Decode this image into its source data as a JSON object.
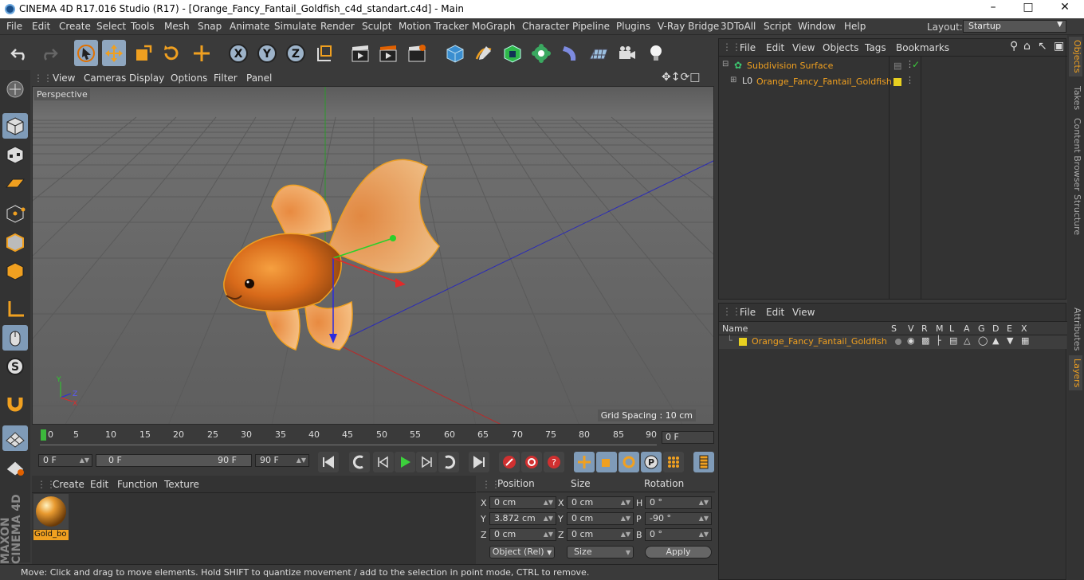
{
  "title": "CINEMA 4D R17.016 Studio (R17) - [Orange_Fancy_Fantail_Goldfish_c4d_standart.c4d] - Main",
  "menu": [
    "File",
    "Edit",
    "Create",
    "Select",
    "Tools",
    "Mesh",
    "Snap",
    "Animate",
    "Simulate",
    "Render",
    "Sculpt",
    "Motion Tracker",
    "MoGraph",
    "Character",
    "Pipeline",
    "Plugins",
    "V-Ray Bridge",
    "3DToAll",
    "Script",
    "Window",
    "Help"
  ],
  "layout": {
    "label": "Layout:",
    "value": "Startup"
  },
  "viewport_menu": [
    "View",
    "Cameras",
    "Display",
    "Options",
    "Filter",
    "Panel"
  ],
  "viewport": {
    "label": "Perspective",
    "grid_spacing": "Grid Spacing : 10 cm"
  },
  "timeline": {
    "ticks": [
      "0",
      "5",
      "10",
      "15",
      "20",
      "25",
      "30",
      "35",
      "40",
      "45",
      "50",
      "55",
      "60",
      "65",
      "70",
      "75",
      "80",
      "85",
      "90"
    ],
    "current": "0 F"
  },
  "transport": {
    "start": "0 F",
    "range_start": "0 F",
    "range_end": "90 F",
    "end": "90 F"
  },
  "material_menu": [
    "Create",
    "Edit",
    "Function",
    "Texture"
  ],
  "material": {
    "name": "Gold_bo"
  },
  "coords": {
    "headers": [
      "Position",
      "Size",
      "Rotation"
    ],
    "pos": [
      {
        "axis": "X",
        "val": "0 cm"
      },
      {
        "axis": "Y",
        "val": "3.872 cm"
      },
      {
        "axis": "Z",
        "val": "0 cm"
      }
    ],
    "size": [
      {
        "axis": "X",
        "val": "0 cm"
      },
      {
        "axis": "Y",
        "val": "0 cm"
      },
      {
        "axis": "Z",
        "val": "0 cm"
      }
    ],
    "rot": [
      {
        "axis": "H",
        "val": "0 °"
      },
      {
        "axis": "P",
        "val": "-90 °"
      },
      {
        "axis": "B",
        "val": "0 °"
      }
    ],
    "mode": "Object (Rel)",
    "size_mode": "Size",
    "apply": "Apply"
  },
  "status": "Move: Click and drag to move elements. Hold SHIFT to quantize movement / add to the selection in point mode, CTRL to remove.",
  "objects_menu": [
    "File",
    "Edit",
    "View",
    "Objects",
    "Tags",
    "Bookmarks"
  ],
  "objects": [
    {
      "name": "Subdivision Surface"
    },
    {
      "name": "Orange_Fancy_Fantail_Goldfish"
    }
  ],
  "layers_menu": [
    "File",
    "Edit",
    "View"
  ],
  "layers": {
    "header": "Name",
    "cols": [
      "S",
      "V",
      "R",
      "M",
      "L",
      "A",
      "G",
      "D",
      "E",
      "X"
    ],
    "row": "Orange_Fancy_Fantail_Goldfish"
  },
  "side_tabs": [
    "Objects",
    "Takes",
    "Content Browser",
    "Structure",
    "Attributes",
    "Layers"
  ],
  "brand": "MAXON CINEMA 4D"
}
